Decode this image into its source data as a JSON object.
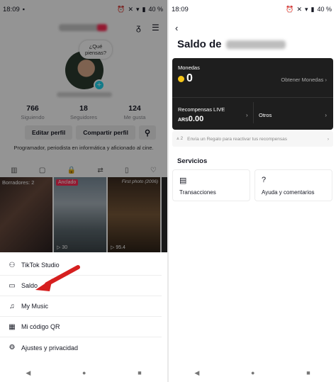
{
  "left": {
    "status": {
      "time": "18:09",
      "battery": "40 %"
    },
    "profile": {
      "bubble_text": "¿Qué piensas?",
      "stats": [
        {
          "value": "766",
          "label": "Siguiendo"
        },
        {
          "value": "18",
          "label": "Seguidores"
        },
        {
          "value": "124",
          "label": "Me gusta"
        }
      ],
      "edit_label": "Editar perfil",
      "share_label": "Compartir perfil",
      "bio": "Programador, periodista en informática y aficionado al cine."
    },
    "grid": {
      "drafts_label": "Borradores: 2",
      "pinned_label": "Anclado",
      "cells": [
        {
          "views": ""
        },
        {
          "views": "30"
        },
        {
          "views": "95.4",
          "title": "First photo (2006)"
        }
      ]
    },
    "menu": [
      {
        "icon": "user-plus-icon",
        "label": "TikTok Studio"
      },
      {
        "icon": "wallet-icon",
        "label": "Saldo"
      },
      {
        "icon": "music-icon",
        "label": "My Music"
      },
      {
        "icon": "qr-icon",
        "label": "Mi código QR"
      },
      {
        "icon": "gear-icon",
        "label": "Ajustes y privacidad"
      }
    ]
  },
  "right": {
    "status": {
      "time": "18:09",
      "battery": "40 %"
    },
    "title": "Saldo de",
    "card": {
      "coins_label": "Monedas",
      "coins_value": "0",
      "get_coins": "Obtener Monedas",
      "live_label": "Recompensas LIVE",
      "others_label": "Otros",
      "ars_prefix": "ARS",
      "ars_value": "0.00"
    },
    "hint": {
      "count": "2",
      "text": "Envía un Regalo para reactivar tus recompensas"
    },
    "services_title": "Servicios",
    "services": [
      {
        "icon": "receipt-icon",
        "label": "Transacciones"
      },
      {
        "icon": "help-icon",
        "label": "Ayuda y comentarios"
      }
    ]
  },
  "colors": {
    "accent": "#fe2c55",
    "arrow": "#d61f1f",
    "card": "#1e1e1e",
    "coin": "#f5c518"
  }
}
